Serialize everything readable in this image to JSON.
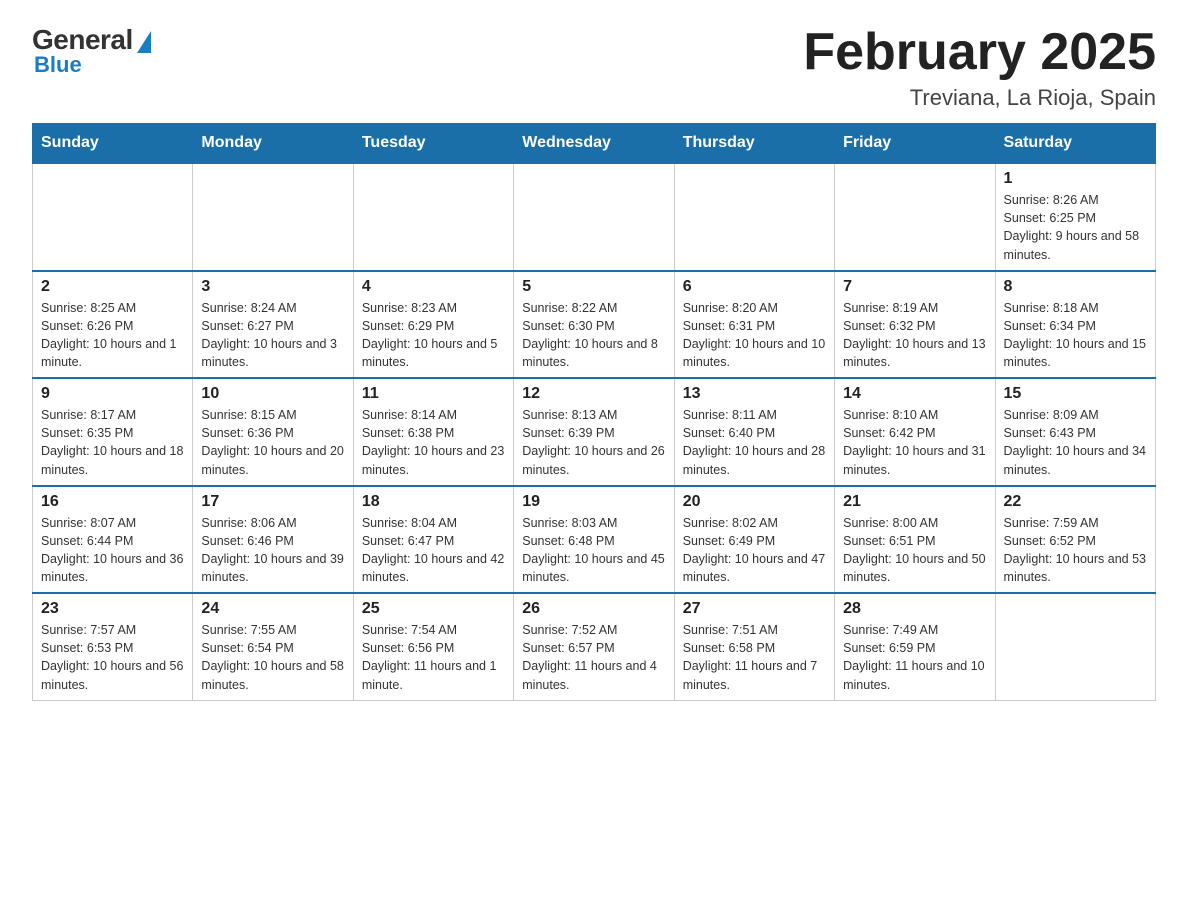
{
  "header": {
    "logo": {
      "general": "General",
      "blue": "Blue"
    },
    "title": "February 2025",
    "location": "Treviana, La Rioja, Spain"
  },
  "days_of_week": [
    "Sunday",
    "Monday",
    "Tuesday",
    "Wednesday",
    "Thursday",
    "Friday",
    "Saturday"
  ],
  "weeks": [
    [
      {
        "day": "",
        "info": ""
      },
      {
        "day": "",
        "info": ""
      },
      {
        "day": "",
        "info": ""
      },
      {
        "day": "",
        "info": ""
      },
      {
        "day": "",
        "info": ""
      },
      {
        "day": "",
        "info": ""
      },
      {
        "day": "1",
        "info": "Sunrise: 8:26 AM\nSunset: 6:25 PM\nDaylight: 9 hours and 58 minutes."
      }
    ],
    [
      {
        "day": "2",
        "info": "Sunrise: 8:25 AM\nSunset: 6:26 PM\nDaylight: 10 hours and 1 minute."
      },
      {
        "day": "3",
        "info": "Sunrise: 8:24 AM\nSunset: 6:27 PM\nDaylight: 10 hours and 3 minutes."
      },
      {
        "day": "4",
        "info": "Sunrise: 8:23 AM\nSunset: 6:29 PM\nDaylight: 10 hours and 5 minutes."
      },
      {
        "day": "5",
        "info": "Sunrise: 8:22 AM\nSunset: 6:30 PM\nDaylight: 10 hours and 8 minutes."
      },
      {
        "day": "6",
        "info": "Sunrise: 8:20 AM\nSunset: 6:31 PM\nDaylight: 10 hours and 10 minutes."
      },
      {
        "day": "7",
        "info": "Sunrise: 8:19 AM\nSunset: 6:32 PM\nDaylight: 10 hours and 13 minutes."
      },
      {
        "day": "8",
        "info": "Sunrise: 8:18 AM\nSunset: 6:34 PM\nDaylight: 10 hours and 15 minutes."
      }
    ],
    [
      {
        "day": "9",
        "info": "Sunrise: 8:17 AM\nSunset: 6:35 PM\nDaylight: 10 hours and 18 minutes."
      },
      {
        "day": "10",
        "info": "Sunrise: 8:15 AM\nSunset: 6:36 PM\nDaylight: 10 hours and 20 minutes."
      },
      {
        "day": "11",
        "info": "Sunrise: 8:14 AM\nSunset: 6:38 PM\nDaylight: 10 hours and 23 minutes."
      },
      {
        "day": "12",
        "info": "Sunrise: 8:13 AM\nSunset: 6:39 PM\nDaylight: 10 hours and 26 minutes."
      },
      {
        "day": "13",
        "info": "Sunrise: 8:11 AM\nSunset: 6:40 PM\nDaylight: 10 hours and 28 minutes."
      },
      {
        "day": "14",
        "info": "Sunrise: 8:10 AM\nSunset: 6:42 PM\nDaylight: 10 hours and 31 minutes."
      },
      {
        "day": "15",
        "info": "Sunrise: 8:09 AM\nSunset: 6:43 PM\nDaylight: 10 hours and 34 minutes."
      }
    ],
    [
      {
        "day": "16",
        "info": "Sunrise: 8:07 AM\nSunset: 6:44 PM\nDaylight: 10 hours and 36 minutes."
      },
      {
        "day": "17",
        "info": "Sunrise: 8:06 AM\nSunset: 6:46 PM\nDaylight: 10 hours and 39 minutes."
      },
      {
        "day": "18",
        "info": "Sunrise: 8:04 AM\nSunset: 6:47 PM\nDaylight: 10 hours and 42 minutes."
      },
      {
        "day": "19",
        "info": "Sunrise: 8:03 AM\nSunset: 6:48 PM\nDaylight: 10 hours and 45 minutes."
      },
      {
        "day": "20",
        "info": "Sunrise: 8:02 AM\nSunset: 6:49 PM\nDaylight: 10 hours and 47 minutes."
      },
      {
        "day": "21",
        "info": "Sunrise: 8:00 AM\nSunset: 6:51 PM\nDaylight: 10 hours and 50 minutes."
      },
      {
        "day": "22",
        "info": "Sunrise: 7:59 AM\nSunset: 6:52 PM\nDaylight: 10 hours and 53 minutes."
      }
    ],
    [
      {
        "day": "23",
        "info": "Sunrise: 7:57 AM\nSunset: 6:53 PM\nDaylight: 10 hours and 56 minutes."
      },
      {
        "day": "24",
        "info": "Sunrise: 7:55 AM\nSunset: 6:54 PM\nDaylight: 10 hours and 58 minutes."
      },
      {
        "day": "25",
        "info": "Sunrise: 7:54 AM\nSunset: 6:56 PM\nDaylight: 11 hours and 1 minute."
      },
      {
        "day": "26",
        "info": "Sunrise: 7:52 AM\nSunset: 6:57 PM\nDaylight: 11 hours and 4 minutes."
      },
      {
        "day": "27",
        "info": "Sunrise: 7:51 AM\nSunset: 6:58 PM\nDaylight: 11 hours and 7 minutes."
      },
      {
        "day": "28",
        "info": "Sunrise: 7:49 AM\nSunset: 6:59 PM\nDaylight: 11 hours and 10 minutes."
      },
      {
        "day": "",
        "info": ""
      }
    ]
  ]
}
